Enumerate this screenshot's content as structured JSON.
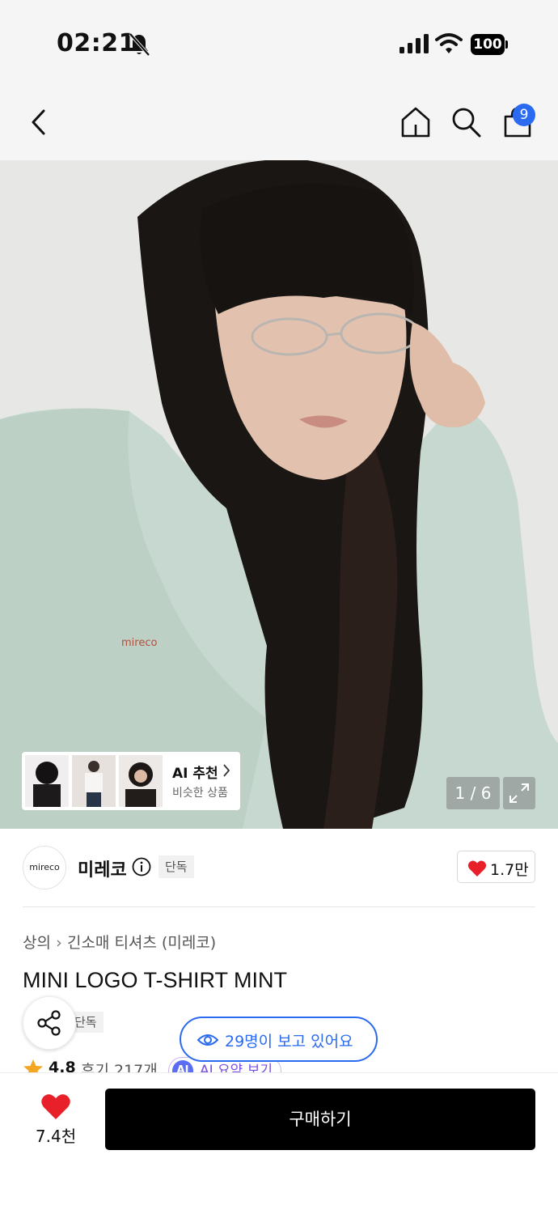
{
  "status_bar": {
    "time": "02:21",
    "battery": "100",
    "icons": [
      "mute-icon",
      "signal-icon",
      "wifi-icon",
      "battery-icon"
    ]
  },
  "nav": {
    "icons": [
      "back-icon",
      "home-icon",
      "search-icon",
      "shopping-bag-icon"
    ],
    "cart_count": "9"
  },
  "gallery": {
    "counter": "1 / 6",
    "ai_recommend": {
      "title": "AI 추천",
      "subtitle": "비슷한 상품"
    }
  },
  "brand": {
    "logo_text": "mireco",
    "name": "미레코",
    "badge": "단독",
    "likes": "1.7만"
  },
  "product": {
    "breadcrumb": [
      "상의",
      "긴소매 티셔츠 (미레코)"
    ],
    "title": "MINI LOGO T-SHIRT MINT",
    "badge": "단독",
    "viewers": "29명이 보고 있어요",
    "rating": "4.8",
    "reviews": "후기 217개",
    "ai_summary": "AI 요약 보기",
    "ai_icon": "AI"
  },
  "bottom": {
    "wish_count": "7.4천",
    "buy_label": "구매하기"
  },
  "colors": {
    "accent_blue": "#2a6af0",
    "heart_red": "#e8202a",
    "ai_purple": "#7a4fe0",
    "buy_black": "#000000"
  }
}
